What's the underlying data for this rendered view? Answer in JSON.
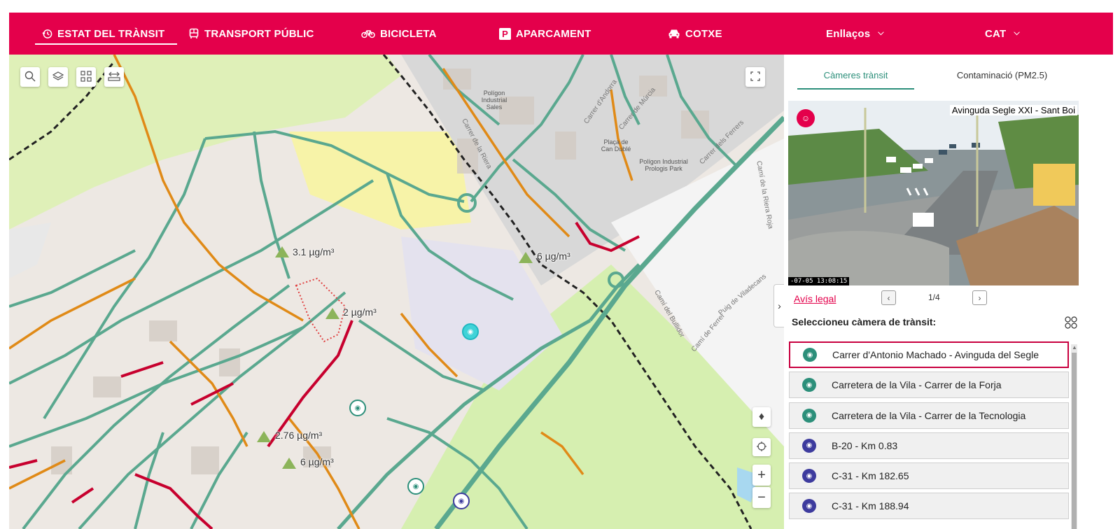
{
  "nav": {
    "items": [
      {
        "label": "ESTAT DEL TRÀNSIT",
        "icon": "history-icon"
      },
      {
        "label": "TRANSPORT PÚBLIC",
        "icon": "bus-icon"
      },
      {
        "label": "BICICLETA",
        "icon": "bicycle-icon"
      },
      {
        "label": "APARCAMENT",
        "icon": "parking-icon"
      },
      {
        "label": "COTXE",
        "icon": "car-icon"
      },
      {
        "label": "Enllaços",
        "icon": "chevron-down-icon"
      },
      {
        "label": "CAT",
        "icon": "chevron-down-icon"
      }
    ],
    "active_index": 0,
    "color": "#e4004b"
  },
  "map": {
    "pm_labels": [
      "3.1 µg/m³",
      "6 µg/m³",
      "2 µg/m³",
      "2.76 µg/m³",
      "6 µg/m³"
    ],
    "places": [
      "Polígon Industrial Sales",
      "Plaça de Can Dublé",
      "Polígon Industrial Prologis Park"
    ],
    "streets": [
      "Carrer de la Riera",
      "Carrer d'Andorra",
      "Carrer de Múrcia",
      "Carrer dels Ferrers",
      "Camí de la Riera Roja",
      "Camí del Bullidor",
      "Camí de Ferrer",
      "Puig de Viladecans"
    ],
    "traffic_colors": {
      "fluid": "#5aa88f",
      "dense": "#e08a17",
      "congested": "#c7002e"
    }
  },
  "panel": {
    "tabs": [
      "Càmeres trànsit",
      "Contaminació (PM2.5)"
    ],
    "active_tab": 0,
    "camera": {
      "caption": "Avinguda Segle XXI - Sant Boi",
      "timestamp": "-07-05 13:08:15"
    },
    "legal_link": "Avís legal",
    "pager": "1/4",
    "select_label": "Seleccioneu càmera de trànsit:",
    "cameras": [
      {
        "name": "Carrer d'Antonio Machado - Avinguda del Segle",
        "color": "#2c8f7a",
        "selected": true
      },
      {
        "name": "Carretera de la Vila - Carrer de la Forja",
        "color": "#2c8f7a",
        "selected": false
      },
      {
        "name": "Carretera de la Vila - Carrer de la Tecnologia",
        "color": "#2c8f7a",
        "selected": false
      },
      {
        "name": "B-20 - Km 0.83",
        "color": "#3d3b9e",
        "selected": false
      },
      {
        "name": "C-31 - Km 182.65",
        "color": "#3d3b9e",
        "selected": false
      },
      {
        "name": "C-31 - Km 188.94",
        "color": "#3d3b9e",
        "selected": false
      }
    ]
  }
}
